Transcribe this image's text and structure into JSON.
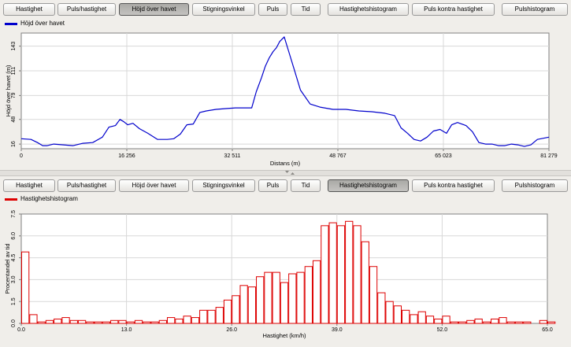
{
  "tabs": [
    "Hastighet",
    "Puls/hastighet",
    "Höjd över havet",
    "Stigningsvinkel",
    "Puls",
    "Tid",
    "Hastighetshistogram",
    "Puls kontra hastighet",
    "Pulshistogram"
  ],
  "top": {
    "active_tab": 2,
    "legend": "Höjd över havet",
    "color": "#0000cc"
  },
  "bottom": {
    "active_tab": 6,
    "legend": "Hastighetshistogram",
    "color": "#dd0000"
  },
  "chart_data": [
    {
      "type": "line",
      "ylabel": "Höjd över havet (m)",
      "xlabel": "Distans (m)",
      "xlim": [
        0,
        81279
      ],
      "ylim": [
        10,
        160
      ],
      "x_ticks": [
        "0",
        "16 256",
        "32 511",
        "48 767",
        "65 023",
        "81 279"
      ],
      "y_ticks": [
        "16",
        "48",
        "79",
        "111",
        "143"
      ],
      "y_tick_values": [
        16,
        48,
        79,
        111,
        143
      ],
      "series": [
        {
          "x": [
            0,
            1500,
            2500,
            3300,
            4000,
            5000,
            6500,
            8000,
            9500,
            11000,
            12500,
            13500,
            14500,
            15200,
            15800,
            16400,
            17200,
            18200,
            19500,
            21000,
            22500,
            23500,
            24500,
            25500,
            26500,
            27500,
            28500,
            30000,
            31500,
            33000,
            34500,
            35500,
            36200,
            37000,
            37600,
            38200,
            38800,
            39300,
            39800,
            40500,
            41200,
            42000,
            43000,
            44500,
            46000,
            48000,
            50000,
            52000,
            54000,
            56000,
            57500,
            58500,
            59500,
            60500,
            61500,
            62500,
            63500,
            64500,
            65500,
            66300,
            67200,
            68500,
            69500,
            70500,
            71500,
            72500,
            73500,
            74500,
            75500,
            76500,
            77500,
            78500,
            79500,
            81279
          ],
          "y": [
            23,
            22,
            18,
            14,
            14,
            16,
            15,
            14,
            17,
            18,
            25,
            38,
            40,
            48,
            45,
            41,
            43,
            36,
            30,
            22,
            22,
            23,
            29,
            41,
            42,
            57,
            59,
            61,
            62,
            63,
            63,
            63,
            84,
            102,
            117,
            128,
            136,
            141,
            149,
            155,
            136,
            114,
            86,
            68,
            64,
            61,
            61,
            59,
            58,
            56,
            53,
            37,
            30,
            22,
            20,
            25,
            33,
            35,
            30,
            41,
            44,
            40,
            32,
            18,
            16,
            16,
            14,
            14,
            16,
            15,
            13,
            15,
            22,
            25
          ]
        }
      ]
    },
    {
      "type": "bar",
      "ylabel": "Procentandel av tid",
      "xlabel": "Hastighet (km/h)",
      "xlim": [
        0,
        65
      ],
      "ylim": [
        0,
        7.5
      ],
      "x_ticks": [
        "0.0",
        "13.0",
        "26.0",
        "39.0",
        "52.0",
        "65.0"
      ],
      "y_ticks": [
        "0.0",
        "1.5",
        "3.0",
        "4.5",
        "6.0",
        "7.5"
      ],
      "bin_width": 1,
      "values": [
        4.9,
        0.6,
        0.1,
        0.2,
        0.3,
        0.4,
        0.2,
        0.2,
        0.1,
        0.1,
        0.1,
        0.2,
        0.2,
        0.1,
        0.2,
        0.1,
        0.1,
        0.2,
        0.4,
        0.3,
        0.5,
        0.4,
        0.9,
        0.9,
        1.1,
        1.6,
        1.9,
        2.6,
        2.5,
        3.2,
        3.5,
        3.5,
        2.8,
        3.4,
        3.5,
        3.9,
        4.3,
        6.7,
        6.9,
        6.7,
        7.0,
        6.7,
        5.6,
        3.9,
        2.1,
        1.5,
        1.2,
        0.9,
        0.6,
        0.8,
        0.5,
        0.3,
        0.5,
        0.1,
        0.1,
        0.2,
        0.3,
        0.1,
        0.3,
        0.4,
        0.1,
        0.1,
        0.1,
        0.0,
        0.2,
        0.1
      ]
    }
  ]
}
